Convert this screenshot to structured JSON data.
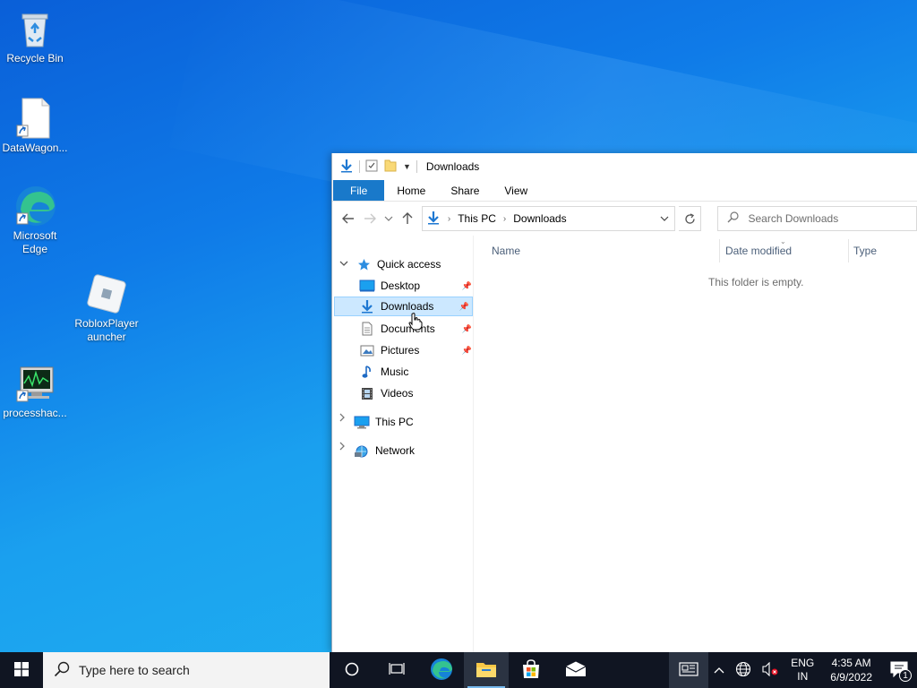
{
  "desktop": {
    "icons": [
      {
        "label": "Recycle Bin"
      },
      {
        "label": "DataWagon..."
      },
      {
        "label": "Microsoft Edge"
      },
      {
        "label": "RobloxPlayer auncher"
      },
      {
        "label": "processhac..."
      }
    ]
  },
  "explorer": {
    "title": "Downloads",
    "ribbon": {
      "file": "File",
      "home": "Home",
      "share": "Share",
      "view": "View"
    },
    "address": {
      "seg1": "This PC",
      "seg2": "Downloads"
    },
    "search_placeholder": "Search Downloads",
    "nav": {
      "quick_access": "Quick access",
      "items": [
        {
          "label": "Desktop"
        },
        {
          "label": "Downloads"
        },
        {
          "label": "Documents"
        },
        {
          "label": "Pictures"
        },
        {
          "label": "Music"
        },
        {
          "label": "Videos"
        }
      ],
      "this_pc": "This PC",
      "network": "Network"
    },
    "columns": {
      "name": "Name",
      "date": "Date modified",
      "type": "Type"
    },
    "empty_text": "This folder is empty."
  },
  "taskbar": {
    "search_placeholder": "Type here to search",
    "lang_line1": "ENG",
    "lang_line2": "IN",
    "time": "4:35 AM",
    "date": "6/9/2022",
    "notification_count": "1"
  }
}
